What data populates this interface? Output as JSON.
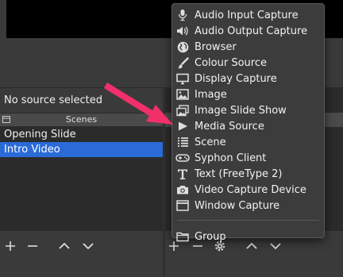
{
  "status": {
    "no_source_text": "No source selected"
  },
  "scenes": {
    "header": "Scenes",
    "items": [
      {
        "label": "Opening Slide",
        "selected": false
      },
      {
        "label": "Intro Video",
        "selected": true
      }
    ]
  },
  "menu": {
    "items": [
      {
        "label": "Audio Input Capture",
        "icon": "microphone-icon"
      },
      {
        "label": "Audio Output Capture",
        "icon": "speaker-icon"
      },
      {
        "label": "Browser",
        "icon": "globe-icon"
      },
      {
        "label": "Colour Source",
        "icon": "paintbrush-icon"
      },
      {
        "label": "Display Capture",
        "icon": "monitor-icon"
      },
      {
        "label": "Image",
        "icon": "image-icon"
      },
      {
        "label": "Image Slide Show",
        "icon": "slideshow-icon"
      },
      {
        "label": "Media Source",
        "icon": "play-icon"
      },
      {
        "label": "Scene",
        "icon": "list-icon"
      },
      {
        "label": "Syphon Client",
        "icon": "gamepad-icon"
      },
      {
        "label": "Text (FreeType 2)",
        "icon": "text-icon"
      },
      {
        "label": "Video Capture Device",
        "icon": "camera-icon"
      },
      {
        "label": "Window Capture",
        "icon": "window-icon"
      }
    ],
    "group_label": "Group"
  },
  "colors": {
    "selection": "#2a6bd8",
    "arrow": "#f0306a"
  }
}
